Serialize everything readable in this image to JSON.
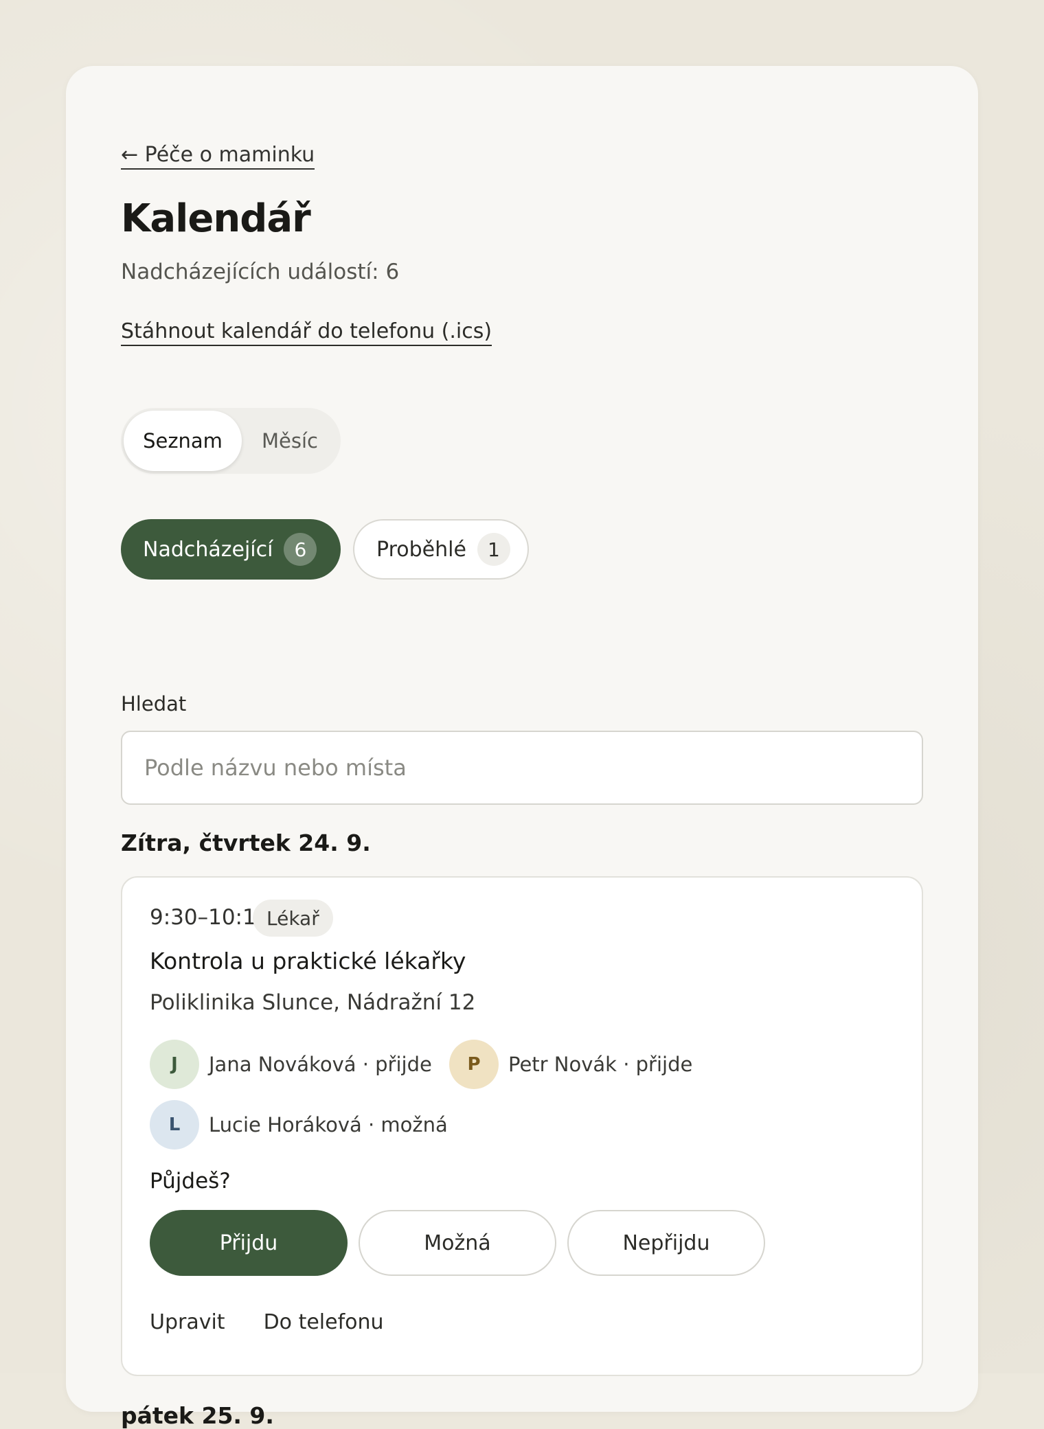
{
  "nav": {
    "back_label": "← Péče o maminku"
  },
  "page": {
    "title": "Kalendář",
    "upcoming_count_text": "Nadcházejících událostí: 6",
    "ics_link": "Stáhnout kalendář do telefonu (.ics)"
  },
  "view_toggle": {
    "list": "Seznam",
    "month": "Měsíc",
    "selected": "Seznam"
  },
  "filters": {
    "upcoming": {
      "label": "Nadcházející",
      "count": "6"
    },
    "past": {
      "label": "Proběhlé",
      "count": "1"
    },
    "selected": "upcoming"
  },
  "search": {
    "label": "Hledat",
    "placeholder": "Podle názvu nebo místa",
    "value": ""
  },
  "days": [
    {
      "heading": "Zítra, čtvrtek 24. 9.",
      "events": [
        {
          "time": "9:30–10:15",
          "tag": "Lékař",
          "title": "Kontrola u praktické lékařky",
          "place": "Poliklinika Slunce, Nádražní 12",
          "attendees": [
            {
              "initial": "J",
              "text": "Jana Nováková · přijde",
              "color_bg": "#dfe9d8",
              "color_fg": "#3d5a3c"
            },
            {
              "initial": "P",
              "text": "Petr Novák · přijde",
              "color_bg": "#f0e2c2",
              "color_fg": "#7a5a1c"
            },
            {
              "initial": "L",
              "text": "Lucie Horáková · možná",
              "color_bg": "#dce6ef",
              "color_fg": "#3a5470"
            }
          ],
          "question": "Půjdeš?",
          "rsvp": {
            "yes": "Přijdu",
            "maybe": "Možná",
            "no": "Nepřijdu",
            "selected": "yes"
          },
          "actions": {
            "edit": "Upravit",
            "to_phone": "Do telefonu"
          }
        }
      ]
    },
    {
      "heading": "pátek 25. 9.",
      "events": []
    }
  ],
  "colors": {
    "accent": "#3d5a3c",
    "card_bg": "#f8f7f4",
    "page_bg": "#ebe7dc"
  }
}
